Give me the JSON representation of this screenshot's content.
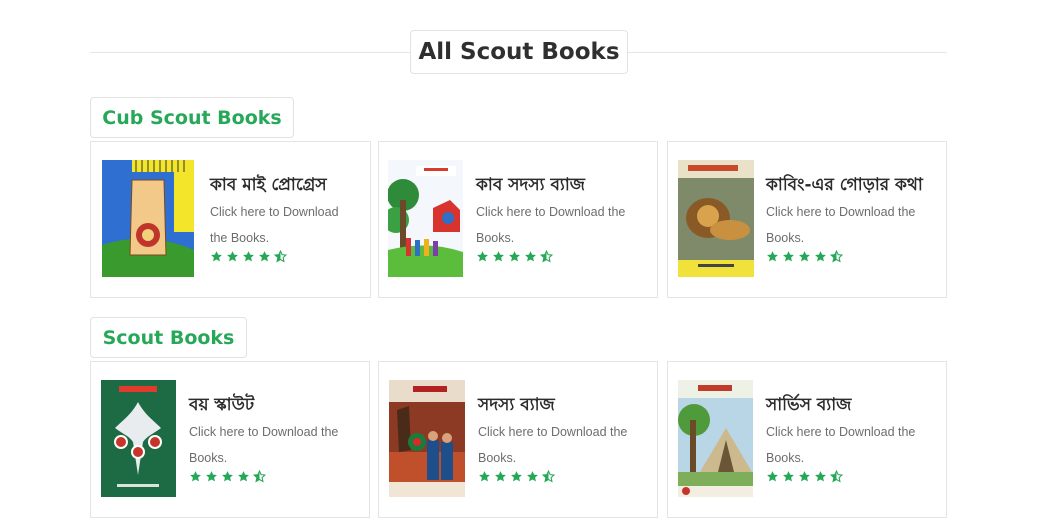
{
  "page": {
    "title": "All Scout Books"
  },
  "colors": {
    "accent": "#27a859",
    "star": "#27a859",
    "text": "#2b2b2b",
    "muted": "#6d6d6d"
  },
  "sections": [
    {
      "label": "Cub Scout Books",
      "books": [
        {
          "title": "কাব মাই প্রোগ্রেস",
          "desc_line1": "Click here to Download",
          "desc_line2": "the Books.",
          "rating": 4.5,
          "cover_icon": "cub-hand-badge-cover"
        },
        {
          "title": "কাব সদস্য ব্যাজ",
          "desc_line1": "Click here to Download the",
          "desc_line2": "Books.",
          "rating": 4.5,
          "cover_icon": "children-tree-cover"
        },
        {
          "title": "কাবিং-এর গোড়ার কথা",
          "desc_line1": "Click here to Download the",
          "desc_line2": "Books.",
          "rating": 4.5,
          "cover_icon": "lion-cover"
        }
      ]
    },
    {
      "label": "Scout Books",
      "books": [
        {
          "title": "বয় স্কাউট",
          "desc_line1": "Click here to Download the",
          "desc_line2": "Books.",
          "rating": 4.5,
          "cover_icon": "scout-emblem-cover"
        },
        {
          "title": "সদস্য ব্যাজ",
          "desc_line1": "Click here to Download the",
          "desc_line2": "Books.",
          "rating": 4.5,
          "cover_icon": "scouts-saluting-cover"
        },
        {
          "title": "সার্ভিস ব্যাজ",
          "desc_line1": "Click here to Download the",
          "desc_line2": "Books.",
          "rating": 4.5,
          "cover_icon": "camp-tent-cover"
        }
      ]
    }
  ]
}
